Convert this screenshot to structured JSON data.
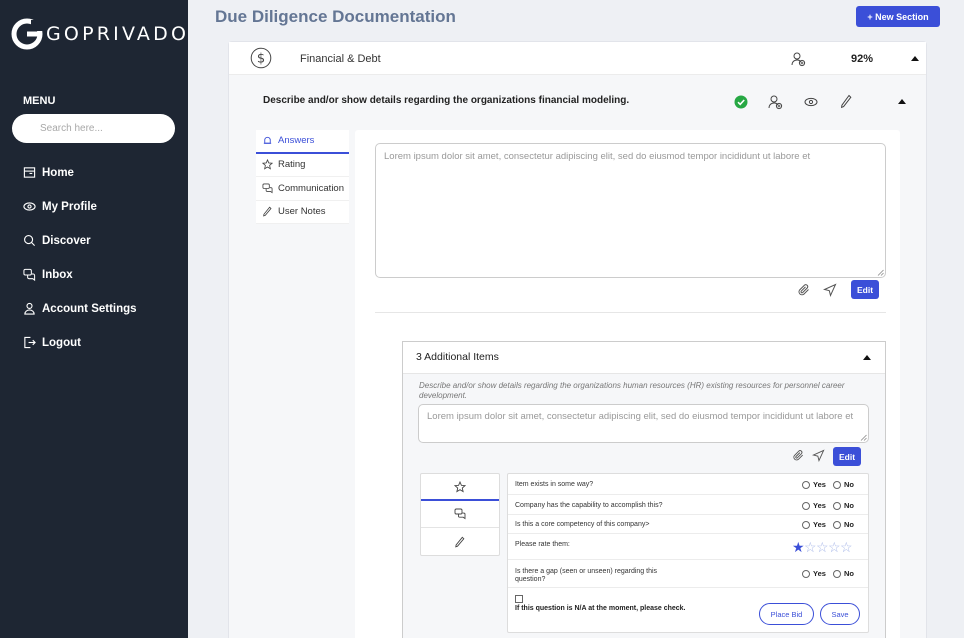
{
  "sidebar": {
    "logo_text": "GOPRIVADO",
    "menu_title": "MENU",
    "search_placeholder": "Search here...",
    "items": [
      {
        "label": "Home",
        "icon": "home-icon"
      },
      {
        "label": "My Profile",
        "icon": "eye-icon"
      },
      {
        "label": "Discover",
        "icon": "search-icon"
      },
      {
        "label": "Inbox",
        "icon": "chat-icon"
      },
      {
        "label": "Account Settings",
        "icon": "user-icon"
      },
      {
        "label": "Logout",
        "icon": "logout-icon"
      }
    ]
  },
  "header": {
    "title": "Due Diligence Documentation",
    "new_section_label": "+ New Section"
  },
  "section": {
    "name": "Financial & Debt",
    "percent": "92%",
    "question": "Describe and/or show details regarding the organizations financial modeling.",
    "tabs": [
      {
        "label": "Answers",
        "icon": "bell-icon"
      },
      {
        "label": "Rating",
        "icon": "star-icon"
      },
      {
        "label": "Communication",
        "icon": "chat-icon"
      },
      {
        "label": "User Notes",
        "icon": "pencil-icon"
      }
    ],
    "answer_text": "Lorem ipsum dolor sit amet, consectetur adipiscing elit, sed do eiusmod tempor incididunt ut labore et",
    "edit_label": "Edit"
  },
  "additional": {
    "title": "3 Additional Items",
    "description": "Describe and/or show details regarding the organizations human resources (HR) existing resources for personnel career development.",
    "answer_text": "Lorem ipsum dolor sit amet, consectetur adipiscing elit, sed do eiusmod tempor incididunt ut labore et",
    "edit_label": "Edit",
    "rating": {
      "questions": [
        "Item exists in some way?",
        "Company has the capability to accomplish this?",
        "Is this a core competency of this company>",
        "Please rate them:",
        "Is there a gap (seen or unseen) regarding this question?"
      ],
      "yes_label": "Yes",
      "no_label": "No",
      "star_rating": 1,
      "star_max": 5,
      "na_text": "If this question is N/A at the moment, please check.",
      "place_bid_label": "Place Bid",
      "save_label": "Save"
    }
  },
  "colors": {
    "sidebar_bg": "#1e2633",
    "accent": "#3b4fd8",
    "success": "#27a844"
  }
}
